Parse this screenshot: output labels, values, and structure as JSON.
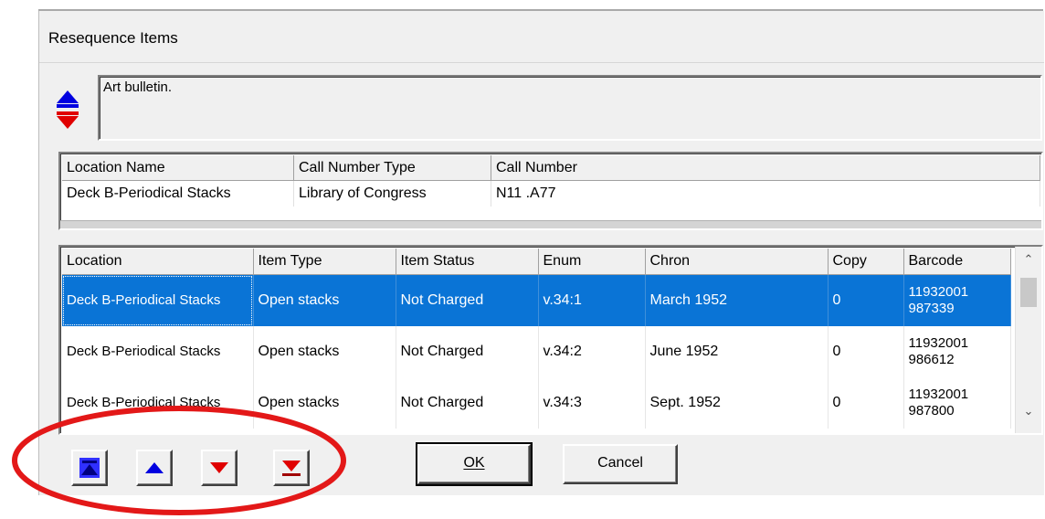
{
  "dialog": {
    "title": "Resequence Items"
  },
  "description": {
    "text": "Art bulletin."
  },
  "location_table": {
    "headers": [
      "Location Name",
      "Call Number Type",
      "Call Number"
    ],
    "row": [
      "Deck B-Periodical Stacks",
      "Library of Congress",
      "N11 .A77"
    ]
  },
  "items_table": {
    "headers": [
      "Location",
      "Item Type",
      "Item Status",
      "Enum",
      "Chron",
      "Copy",
      "Barcode"
    ],
    "rows": [
      {
        "location": "Deck B-Periodical Stacks",
        "item_type": "Open stacks",
        "item_status": "Not Charged",
        "enum": "v.34:1",
        "chron": "March 1952",
        "copy": "0",
        "barcode": "11932001 987339",
        "selected": true
      },
      {
        "location": "Deck B-Periodical Stacks",
        "item_type": "Open stacks",
        "item_status": "Not Charged",
        "enum": "v.34:2",
        "chron": "June 1952",
        "copy": "0",
        "barcode": "11932001 986612",
        "selected": false
      },
      {
        "location": "Deck B-Periodical Stacks",
        "item_type": "Open stacks",
        "item_status": "Not Charged",
        "enum": "v.34:3",
        "chron": "Sept. 1952",
        "copy": "0",
        "barcode": "11932001 987800",
        "selected": false
      }
    ]
  },
  "buttons": {
    "ok_label": "OK",
    "cancel_label": "Cancel",
    "move_top_icon": "move-to-top-icon",
    "move_up_icon": "move-up-icon",
    "move_down_icon": "move-down-icon",
    "move_bottom_icon": "move-to-bottom-icon"
  },
  "colors": {
    "selection": "#0a74d6",
    "arrow_blue": "#0000e0",
    "arrow_red": "#e00000",
    "annotation_circle": "#e31818"
  }
}
